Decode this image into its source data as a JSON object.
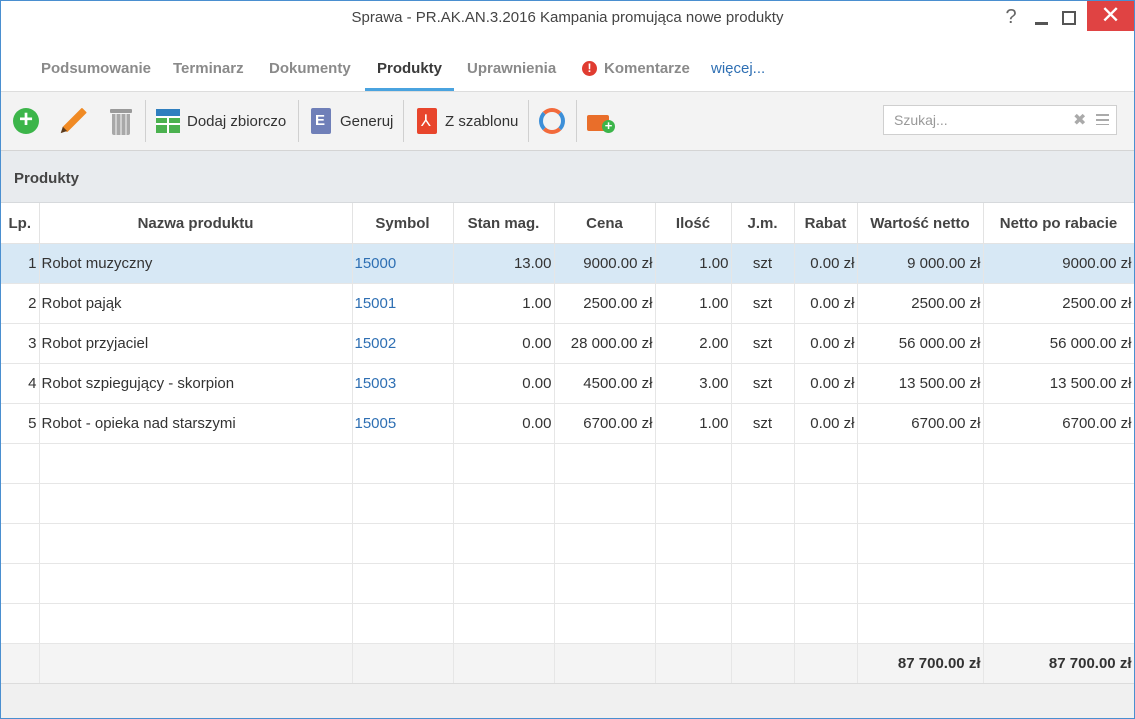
{
  "window": {
    "title": "Sprawa - PR.AK.AN.3.2016 Kampania promująca nowe produkty",
    "help": "?",
    "close": "✕"
  },
  "tabs": [
    {
      "label": "Podsumowanie"
    },
    {
      "label": "Terminarz"
    },
    {
      "label": "Dokumenty"
    },
    {
      "label": "Produkty",
      "active": true
    },
    {
      "label": "Uprawnienia"
    },
    {
      "label": "Komentarze",
      "icon": "alert-icon"
    },
    {
      "label": "więcej..."
    }
  ],
  "toolbar": {
    "add_icon": "add-icon",
    "edit_icon": "pencil-icon",
    "delete_icon": "trash-icon",
    "bulk_add_label": "Dodaj zbiorczo",
    "generate_label": "Generuj",
    "template_label": "Z szablonu",
    "refresh_icon": "sync-icon",
    "case_icon": "briefcase-add-icon"
  },
  "search": {
    "placeholder": "Szukaj...",
    "value": ""
  },
  "section": {
    "title": "Produkty"
  },
  "table": {
    "columns": [
      "Lp.",
      "Nazwa produktu",
      "Symbol",
      "Stan mag.",
      "Cena",
      "Ilość",
      "J.m.",
      "Rabat",
      "Wartość netto",
      "Netto po rabacie"
    ],
    "rows": [
      {
        "lp": "1",
        "name": "Robot muzyczny",
        "symbol": "15000",
        "stock": "13.00",
        "price": "9000.00 zł",
        "qty": "1.00",
        "unit": "szt",
        "discount": "0.00 zł",
        "net": "9 000.00 zł",
        "net_after": "9000.00 zł",
        "selected": true
      },
      {
        "lp": "2",
        "name": "Robot pająk",
        "symbol": "15001",
        "stock": "1.00",
        "price": "2500.00 zł",
        "qty": "1.00",
        "unit": "szt",
        "discount": "0.00 zł",
        "net": "2500.00 zł",
        "net_after": "2500.00 zł"
      },
      {
        "lp": "3",
        "name": "Robot przyjaciel",
        "symbol": "15002",
        "stock": "0.00",
        "price": "28 000.00 zł",
        "qty": "2.00",
        "unit": "szt",
        "discount": "0.00 zł",
        "net": "56 000.00 zł",
        "net_after": "56 000.00 zł"
      },
      {
        "lp": "4",
        "name": "Robot szpiegujący - skorpion",
        "symbol": "15003",
        "stock": "0.00",
        "price": "4500.00 zł",
        "qty": "3.00",
        "unit": "szt",
        "discount": "0.00 zł",
        "net": "13 500.00 zł",
        "net_after": "13 500.00 zł"
      },
      {
        "lp": "5",
        "name": "Robot - opieka nad starszymi",
        "symbol": "15005",
        "stock": "0.00",
        "price": "6700.00 zł",
        "qty": "1.00",
        "unit": "szt",
        "discount": "0.00 zł",
        "net": "6700.00 zł",
        "net_after": "6700.00 zł"
      }
    ],
    "totals": {
      "net": "87 700.00 zł",
      "net_after": "87 700.00 zł"
    }
  }
}
